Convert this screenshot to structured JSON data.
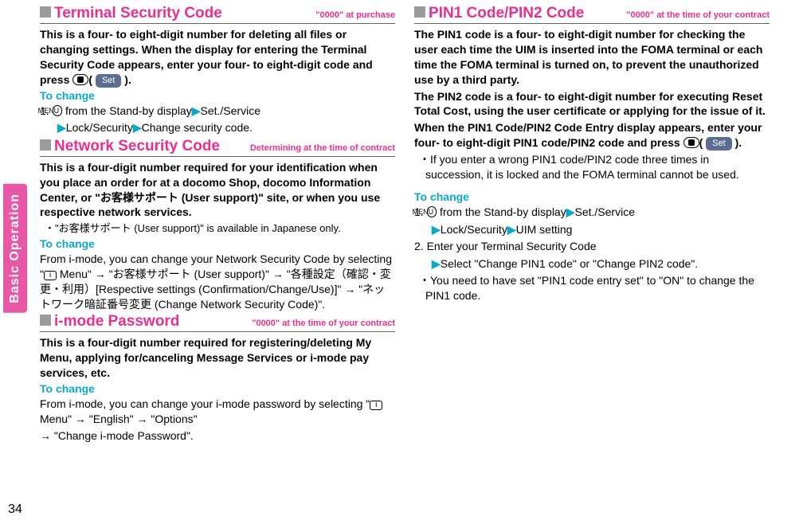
{
  "side": {
    "tab": "Basic Operation",
    "page": "34"
  },
  "left": {
    "sec1": {
      "title": "Terminal Security Code",
      "sub": "\"0000\" at purchase",
      "desc_pre": "This is a four- to eight-digit number for deleting all files or changing settings. When the display for entering the Terminal Security Code appears, enter your four- to eight-digit code and press ",
      "set": "Set",
      "desc_post": ").",
      "to_change": "To change",
      "step1_a": "1. ",
      "menu": "MENU",
      "step1_b": " from the Stand-by display",
      "step1_c": "Set./Service",
      "step1_d": "Lock/Security",
      "step1_e": "Change security code."
    },
    "sec2": {
      "title": "Network Security Code",
      "sub": "Determining at the time of contract",
      "desc": "This is a four-digit number required for your identification when you place an order for at a docomo Shop, docomo Information Center, or \"お客様サポート (User support)\" site, or when you use respective network services.",
      "bullet": "・\"お客様サポート (User support)\" is available in Japanese only.",
      "to_change": "To change",
      "body_a": "From i-mode, you can change your Network Security Code by selecting \"",
      "body_b": "Menu\" → \"お客様サポート (User support)\" → \"各種設定（確認・変更・利用）[Respective settings (Confirmation/Change/Use)]\" → \"ネットワーク暗証番号変更 (Change Network Security Code)\"."
    },
    "sec3": {
      "title": "i-mode Password",
      "sub": "\"0000\" at the time of your contract",
      "desc": "This is a four-digit number required for registering/deleting My Menu, applying for/canceling Message Services or i-mode pay services, etc.",
      "to_change": "To change",
      "body_a": "From i-mode, you can change your i-mode password by selecting \"",
      "body_b": "Menu\" → \"English\" → \"Options\"",
      "body_c": "→ \"Change i-mode Password\"."
    }
  },
  "right": {
    "sec1": {
      "title": "PIN1 Code/PIN2 Code",
      "sub": "\"0000\" at the time of your contract",
      "p1": "The PIN1 code is a four- to eight-digit number for checking the user each time the UIM is inserted into the FOMA terminal or each time the FOMA terminal is turned on, to prevent the unauthorized use by a third party.",
      "p2": "The PIN2 code is a four- to eight-digit number for executing Reset Total Cost, using the user certificate or applying for the issue of it.",
      "p3a": "When the PIN1 Code/PIN2 Code Entry display appears, enter your four- to eight-digit PIN1 code/PIN2 code and press ",
      "set": "Set",
      "p3b": ").",
      "bullet1": "・If you enter a wrong PIN1 code/PIN2 code three times in succession, it is locked and the FOMA terminal cannot be used.",
      "to_change": "To change",
      "step1_a": "1. ",
      "menu": "MENU",
      "step1_b": " from the Stand-by display",
      "step1_c": "Set./Service",
      "step1_d": "Lock/Security",
      "step1_e": "UIM setting",
      "step2_a": "2. Enter your Terminal Security Code",
      "step2_b": "Select \"Change PIN1 code\" or \"Change PIN2 code\".",
      "bullet2": "・You need to have set \"PIN1 code entry set\" to \"ON\" to change the PIN1 code."
    }
  }
}
